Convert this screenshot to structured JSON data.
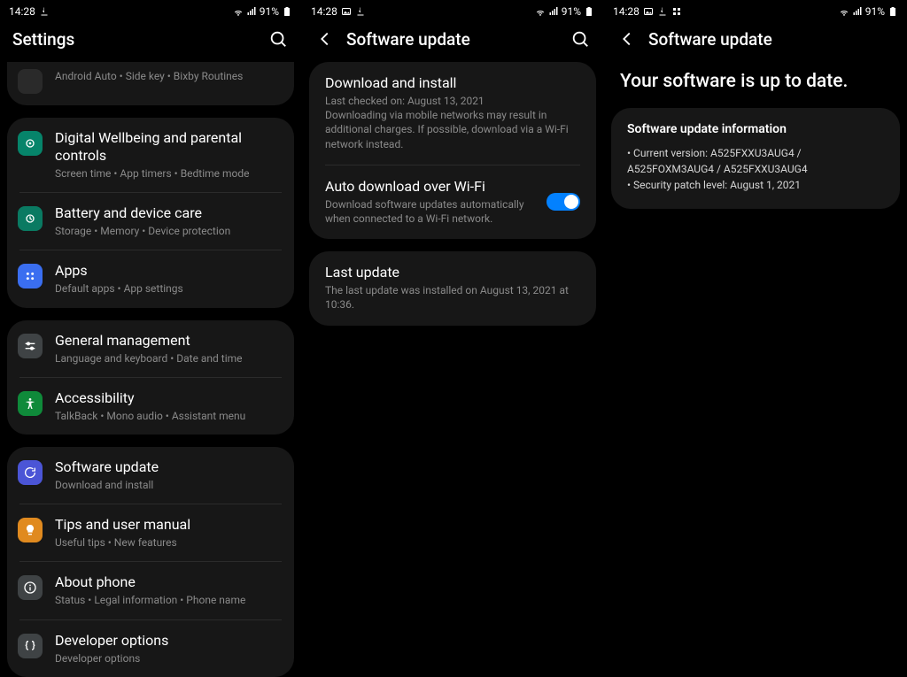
{
  "status": {
    "time": "14:28",
    "battery_pct": "91%"
  },
  "pane1": {
    "header": "Settings",
    "groups": [
      {
        "clipped_prev": {
          "sub": "Android Auto  •  Side key  •  Bixby Routines"
        },
        "items": [
          {
            "icon": "wellbeing-icon",
            "color": "bg-green",
            "title": "Digital Wellbeing and parental controls",
            "sub": "Screen time  •  App timers  •  Bedtime mode"
          },
          {
            "icon": "battery-icon",
            "color": "bg-teal",
            "title": "Battery and device care",
            "sub": "Storage  •  Memory  •  Device protection"
          },
          {
            "icon": "apps-icon",
            "color": "bg-blue",
            "title": "Apps",
            "sub": "Default apps  •  App settings"
          }
        ]
      },
      {
        "items": [
          {
            "icon": "sliders-icon",
            "color": "bg-grey",
            "title": "General management",
            "sub": "Language and keyboard  •  Date and time"
          },
          {
            "icon": "a11y-icon",
            "color": "bg-green2",
            "title": "Accessibility",
            "sub": "TalkBack  •  Mono audio  •  Assistant menu"
          }
        ]
      },
      {
        "items": [
          {
            "icon": "update-icon",
            "color": "bg-purple",
            "title": "Software update",
            "sub": "Download and install"
          },
          {
            "icon": "bulb-icon",
            "color": "bg-orange",
            "title": "Tips and user manual",
            "sub": "Useful tips  •  New features"
          },
          {
            "icon": "info-icon",
            "color": "bg-dgrey",
            "title": "About phone",
            "sub": "Status  •  Legal information  •  Phone name"
          },
          {
            "icon": "braces-icon",
            "color": "bg-dgrey",
            "title": "Developer options",
            "sub": "Developer options"
          }
        ]
      }
    ]
  },
  "pane2": {
    "header": "Software update",
    "download": {
      "title": "Download and install",
      "line1": "Last checked on: August 13, 2021",
      "line2": "Downloading via mobile networks may result in additional charges. If possible, download via a Wi-Fi network instead."
    },
    "auto": {
      "title": "Auto download over Wi-Fi",
      "sub": "Download software updates automatically when connected to a Wi-Fi network.",
      "on": true
    },
    "last": {
      "title": "Last update",
      "sub": "The last update was installed on August 13, 2021 at 10:36."
    }
  },
  "pane3": {
    "header": "Software update",
    "headline": "Your software is up to date.",
    "info_title": "Software update information",
    "bullets": [
      "Current version: A525FXXU3AUG4 / A525FOXM3AUG4 / A525FXXU3AUG4",
      "Security patch level: August 1, 2021"
    ]
  }
}
